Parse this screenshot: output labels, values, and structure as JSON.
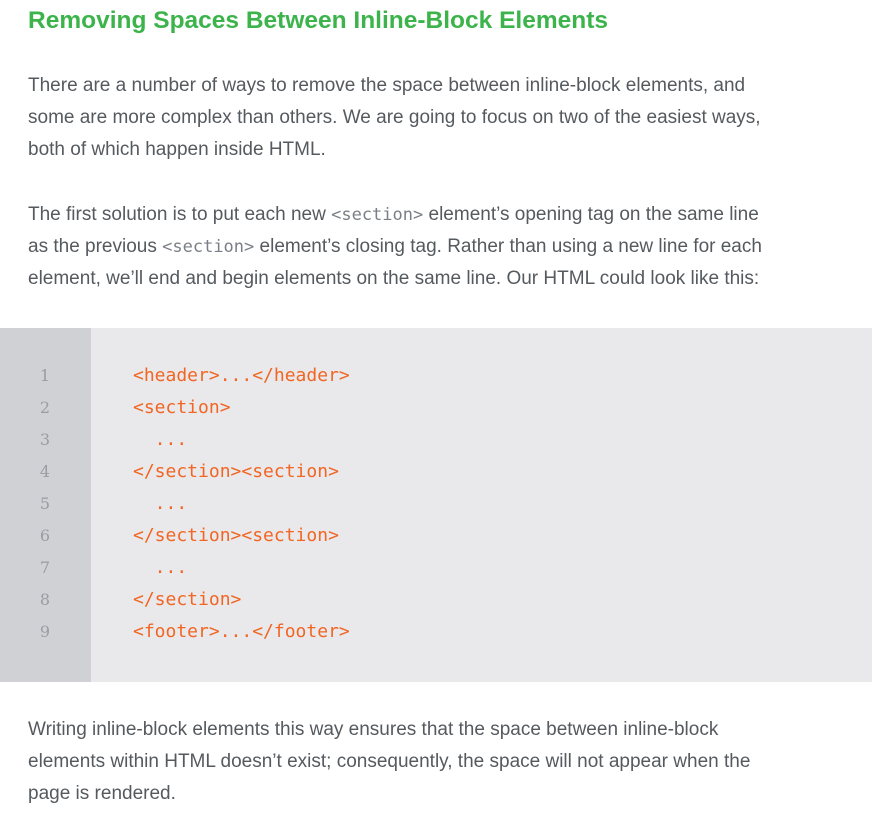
{
  "heading": "Removing Spaces Between Inline-Block Elements",
  "paragraph1": {
    "lines": [
      "There are a number of ways to remove the space between inline-block elements, and",
      "some are more complex than others. We are going to focus on two of the easiest ways,",
      "both of which happen inside HTML."
    ]
  },
  "paragraph2": {
    "line1": {
      "before": "The first solution is to put each new ",
      "code": "<section>",
      "after": " element’s opening tag on the same line"
    },
    "line2": {
      "before": "as the previous ",
      "code": "<section>",
      "after": " element’s closing tag. Rather than using a new line for each"
    },
    "line3": "element, we’ll end and begin elements on the same line. Our HTML could look like this:"
  },
  "code_block": {
    "line_numbers": [
      "1",
      "2",
      "3",
      "4",
      "5",
      "6",
      "7",
      "8",
      "9"
    ],
    "lines": [
      "<header>...</header>",
      "<section>",
      "  ...",
      "</section><section>",
      "  ...",
      "</section><section>",
      "  ...",
      "</section>",
      "<footer>...</footer>"
    ]
  },
  "paragraph3": {
    "lines": [
      "Writing inline-block elements this way ensures that the space between inline-block",
      "elements within HTML doesn’t exist; consequently, the space will not appear when the",
      "page is rendered."
    ]
  }
}
